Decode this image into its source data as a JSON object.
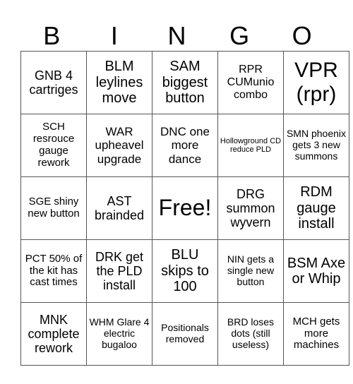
{
  "header": {
    "letters": [
      "B",
      "I",
      "N",
      "G",
      "O"
    ]
  },
  "board": {
    "rows": [
      [
        "GNB 4 cartriges",
        "BLM leylines move",
        "SAM biggest button",
        "RPR CUMunio combo",
        "VPR (rpr)"
      ],
      [
        "SCH resrouce gauge rework",
        "WAR upheavel upgrade",
        "DNC one more dance",
        "Hollowground CD reduce PLD",
        "SMN phoenix gets 3 new summons"
      ],
      [
        "SGE shiny new button",
        "AST brainded",
        "Free!",
        "DRG summon wyvern",
        "RDM gauge install"
      ],
      [
        "PCT 50% of the kit has cast times",
        "DRK get the PLD install",
        "BLU skips to 100",
        "NIN gets a single new button",
        "BSM Axe or Whip"
      ],
      [
        "MNK complete rework",
        "WHM Glare 4 electric bugaloo",
        "Positionals removed",
        "BRD loses dots (still useless)",
        "MCH gets more machines"
      ]
    ]
  },
  "colors": {
    "grid_line": "#555555",
    "text": "#000000",
    "background": "#ffffff"
  }
}
